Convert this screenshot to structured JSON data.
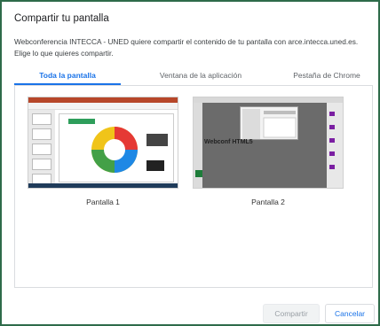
{
  "dialog": {
    "title": "Compartir tu pantalla",
    "description": "Webconferencia INTECCA - UNED quiere compartir el contenido de tu pantalla con arce.intecca.uned.es. Elige lo que quieres compartir."
  },
  "tabs": [
    {
      "label": "Toda la pantalla",
      "active": true
    },
    {
      "label": "Ventana de la aplicación",
      "active": false
    },
    {
      "label": "Pestaña de Chrome",
      "active": false
    }
  ],
  "sources": [
    {
      "label": "Pantalla 1"
    },
    {
      "label": "Pantalla 2",
      "overlay_text": "Webconf HTML5"
    }
  ],
  "buttons": {
    "share_label": "Compartir",
    "cancel_label": "Cancelar"
  },
  "colors": {
    "accent": "#1a73e8",
    "window_border": "#2e6b4a"
  }
}
